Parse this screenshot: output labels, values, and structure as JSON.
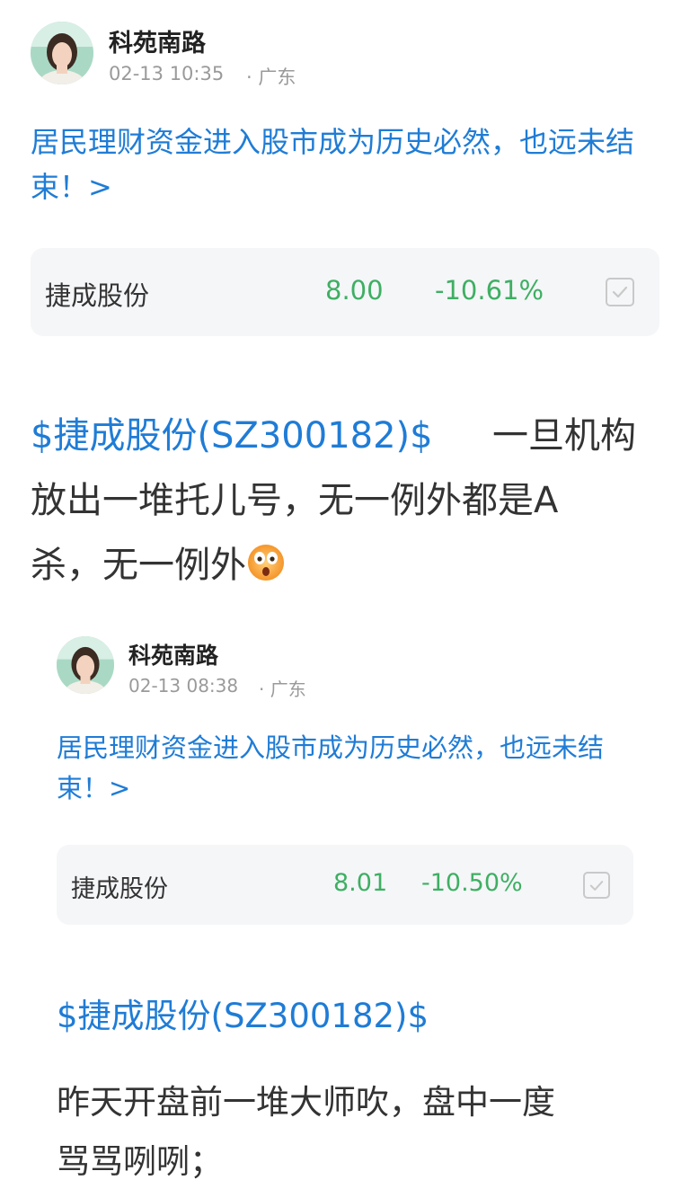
{
  "post": {
    "author": "科苑南路",
    "time": "02-13 10:35",
    "location": "· 广东",
    "link_title": "居民理财资金进入股市成为历史必然，也远未结束！>",
    "quote": {
      "name": "捷成股份",
      "price": "8.00",
      "change": "-10.61%"
    },
    "body_tag": "$捷成股份(SZ300182)$",
    "body_line1_rest": "一旦机构",
    "body_line2": "放出一堆托儿号，无一例外都是A",
    "body_line3": "杀，无一例外",
    "emoji": "astonished-face-emoji"
  },
  "repost": {
    "author": "科苑南路",
    "time": "02-13 08:38",
    "location": "· 广东",
    "link_title": "居民理财资金进入股市成为历史必然，也远未结束！>",
    "quote": {
      "name": "捷成股份",
      "price": "8.01",
      "change": "-10.50%"
    },
    "body_tag": "$捷成股份(SZ300182)$",
    "body_line1": "昨天开盘前一堆大师吹，盘中一度",
    "body_line2": "骂骂咧咧；"
  },
  "colors": {
    "link_blue": "#1f7cd6",
    "stock_green": "#3eaf63",
    "card_bg": "#f5f6f8"
  }
}
